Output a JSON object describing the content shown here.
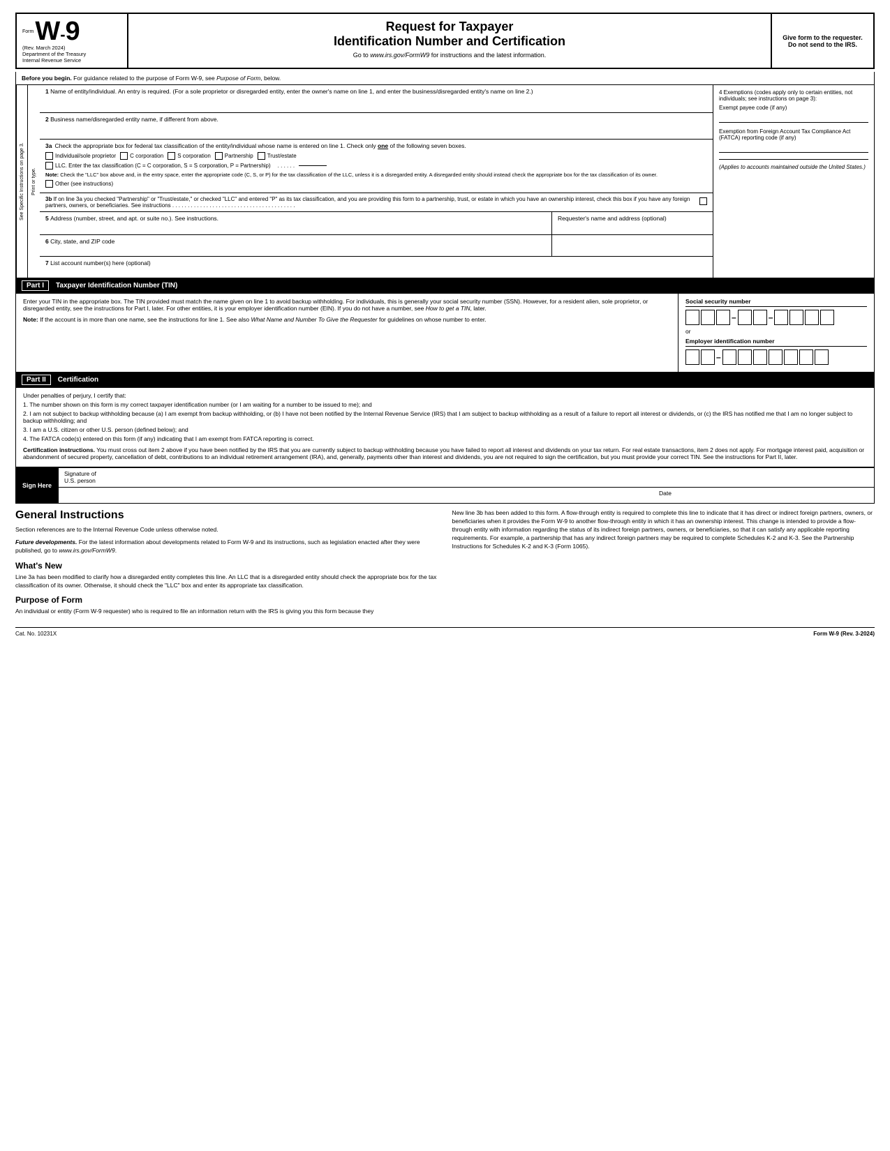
{
  "header": {
    "form_label": "Form",
    "form_number": "W-9",
    "rev_date": "(Rev. March 2024)",
    "dept": "Department of the Treasury",
    "irs": "Internal Revenue Service",
    "title1": "Request for Taxpayer",
    "title2": "Identification Number and Certification",
    "subtitle": "Go to www.irs.gov/FormW9 for instructions and the latest information.",
    "give_form": "Give form to the requester. Do not send to the IRS."
  },
  "before_begin": {
    "label": "Before you begin.",
    "text": "For guidance related to the purpose of Form W-9, see Purpose of Form, below."
  },
  "fields": {
    "field1_label": "1",
    "field1_text": "Name of entity/individual. An entry is required. (For a sole proprietor or disregarded entity, enter the owner's name on line 1, and enter the business/disregarded entity's name on line 2.)",
    "field2_label": "2",
    "field2_text": "Business name/disregarded entity name, if different from above.",
    "field3a_label": "3a",
    "field3a_text": "Check the appropriate box for federal tax classification of the entity/individual whose name is entered on line 1. Check only one of the following seven boxes.",
    "checkbox1": "Individual/sole proprietor",
    "checkbox2": "C corporation",
    "checkbox3": "S corporation",
    "checkbox4": "Partnership",
    "checkbox5": "Trust/estate",
    "checkbox6_text": "LLC. Enter the tax classification (C = C corporation, S = S corporation, P = Partnership)",
    "note_3a": "Note: Check the \"LLC\" box above and, in the entry space, enter the appropriate code (C, S, or P) for the tax classification of the LLC, unless it is a disregarded entity. A disregarded entity should instead check the appropriate box for the tax classification of its owner.",
    "checkbox7": "Other (see instructions)",
    "field3b_text": "3b If on line 3a you checked \"Partnership\" or \"Trust/estate,\" or checked \"LLC\" and entered \"P\" as its tax classification, and you are providing this form to a partnership, trust, or estate in which you have an ownership interest, check this box if you have any foreign partners, owners, or beneficiaries. See instructions",
    "field5_label": "5",
    "field5_text": "Address (number, street, and apt. or suite no.). See instructions.",
    "field5_right": "Requester's name and address (optional)",
    "field6_label": "6",
    "field6_text": "City, state, and ZIP code",
    "field7_label": "7",
    "field7_text": "List account number(s) here (optional)"
  },
  "exemptions": {
    "label": "4 Exemptions (codes apply only to certain entities, not individuals; see instructions on page 3):",
    "exempt_payee": "Exempt payee code (if any)",
    "fatca_label": "Exemption from Foreign Account Tax Compliance Act (FATCA) reporting code (if any)",
    "applies": "(Applies to accounts maintained outside the United States.)"
  },
  "sidebar_text": "See Specific Instructions on page 3.",
  "sidebar_print": "Print or type.",
  "part1": {
    "label": "Part I",
    "title": "Taxpayer Identification Number (TIN)",
    "tin_text": "Enter your TIN in the appropriate box. The TIN provided must match the name given on line 1 to avoid backup withholding. For individuals, this is generally your social security number (SSN). However, for a resident alien, sole proprietor, or disregarded entity, see the instructions for Part I, later. For other entities, it is your employer identification number (EIN). If you do not have a number, see How to get a TIN, later.",
    "note_text": "Note: If the account is in more than one name, see the instructions for line 1. See also What Name and Number To Give the Requester for guidelines on whose number to enter.",
    "ssn_label": "Social security number",
    "or_label": "or",
    "ein_label": "Employer identification number"
  },
  "part2": {
    "label": "Part II",
    "title": "Certification",
    "perjury_text": "Under penalties of perjury, I certify that:",
    "item1": "1. The number shown on this form is my correct taxpayer identification number (or I am waiting for a number to be issued to me); and",
    "item2": "2. I am not subject to backup withholding because (a) I am exempt from backup withholding, or (b) I have not been notified by the Internal Revenue Service (IRS) that I am subject to backup withholding as a result of a failure to report all interest or dividends, or (c) the IRS has notified me that I am no longer subject to backup withholding; and",
    "item3": "3. I am a U.S. citizen or other U.S. person (defined below); and",
    "item4": "4. The FATCA code(s) entered on this form (if any) indicating that I am exempt from FATCA reporting is correct.",
    "cert_instructions_label": "Certification instructions.",
    "cert_instructions_text": "You must cross out item 2 above if you have been notified by the IRS that you are currently subject to backup withholding because you have failed to report all interest and dividends on your tax return. For real estate transactions, item 2 does not apply. For mortgage interest paid, acquisition or abandonment of secured property, cancellation of debt, contributions to an individual retirement arrangement (IRA), and, generally, payments other than interest and dividends, you are not required to sign the certification, but you must provide your correct TIN. See the instructions for Part II, later."
  },
  "sign": {
    "sign_label": "Sign Here",
    "sig_of": "Signature of",
    "us_person": "U.S. person",
    "date_label": "Date"
  },
  "general_instructions": {
    "heading": "General Instructions",
    "para1": "Section references are to the Internal Revenue Code unless otherwise noted.",
    "future_label": "Future developments.",
    "future_text": "For the latest information about developments related to Form W-9 and its instructions, such as legislation enacted after they were published, go to www.irs.gov/FormW9.",
    "whats_new_heading": "What's New",
    "whats_new_para": "Line 3a has been modified to clarify how a disregarded entity completes this line. An LLC that is a disregarded entity should check the appropriate box for the tax classification of its owner. Otherwise, it should check the \"LLC\" box and enter its appropriate tax classification.",
    "purpose_heading": "Purpose of Form",
    "purpose_text": "An individual or entity (Form W-9 requester) who is required to file an information return with the IRS is giving you this form because they"
  },
  "general_instructions_right": {
    "para1": "New line 3b has been added to this form. A flow-through entity is required to complete this line to indicate that it has direct or indirect foreign partners, owners, or beneficiaries when it provides the Form W-9 to another flow-through entity in which it has an ownership interest. This change is intended to provide a flow-through entity with information regarding the status of its indirect foreign partners, owners, or beneficiaries, so that it can satisfy any applicable reporting requirements. For example, a partnership that has any indirect foreign partners may be required to complete Schedules K-2 and K-3. See the Partnership Instructions for Schedules K-2 and K-3 (Form 1065)."
  },
  "footer": {
    "cat_no": "Cat. No. 10231X",
    "form_ref": "Form W-9 (Rev. 3-2024)"
  }
}
